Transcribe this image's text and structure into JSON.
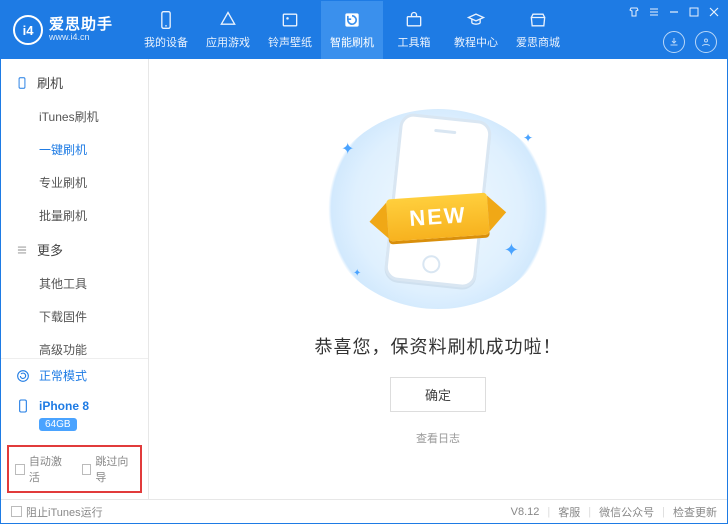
{
  "brand": {
    "name": "爱思助手",
    "site": "www.i4.cn",
    "logo_text": "i4"
  },
  "topnav": [
    {
      "label": "我的设备"
    },
    {
      "label": "应用游戏"
    },
    {
      "label": "铃声壁纸"
    },
    {
      "label": "智能刷机"
    },
    {
      "label": "工具箱"
    },
    {
      "label": "教程中心"
    },
    {
      "label": "爱思商城"
    }
  ],
  "sidebar": {
    "group1_title": "刷机",
    "group1_items": [
      "iTunes刷机",
      "一键刷机",
      "专业刷机",
      "批量刷机"
    ],
    "group2_title": "更多",
    "group2_items": [
      "其他工具",
      "下载固件",
      "高级功能"
    ]
  },
  "mode": {
    "label": "正常模式"
  },
  "device": {
    "name": "iPhone 8",
    "capacity": "64GB"
  },
  "bottom_checks": {
    "auto_activate": "自动激活",
    "skip_guide": "跳过向导"
  },
  "main": {
    "ribbon": "NEW",
    "success": "恭喜您，保资料刷机成功啦！",
    "ok": "确定",
    "view_log": "查看日志"
  },
  "status": {
    "block_itunes": "阻止iTunes运行",
    "version": "V8.12",
    "support": "客服",
    "wechat": "微信公众号",
    "update": "检查更新"
  }
}
